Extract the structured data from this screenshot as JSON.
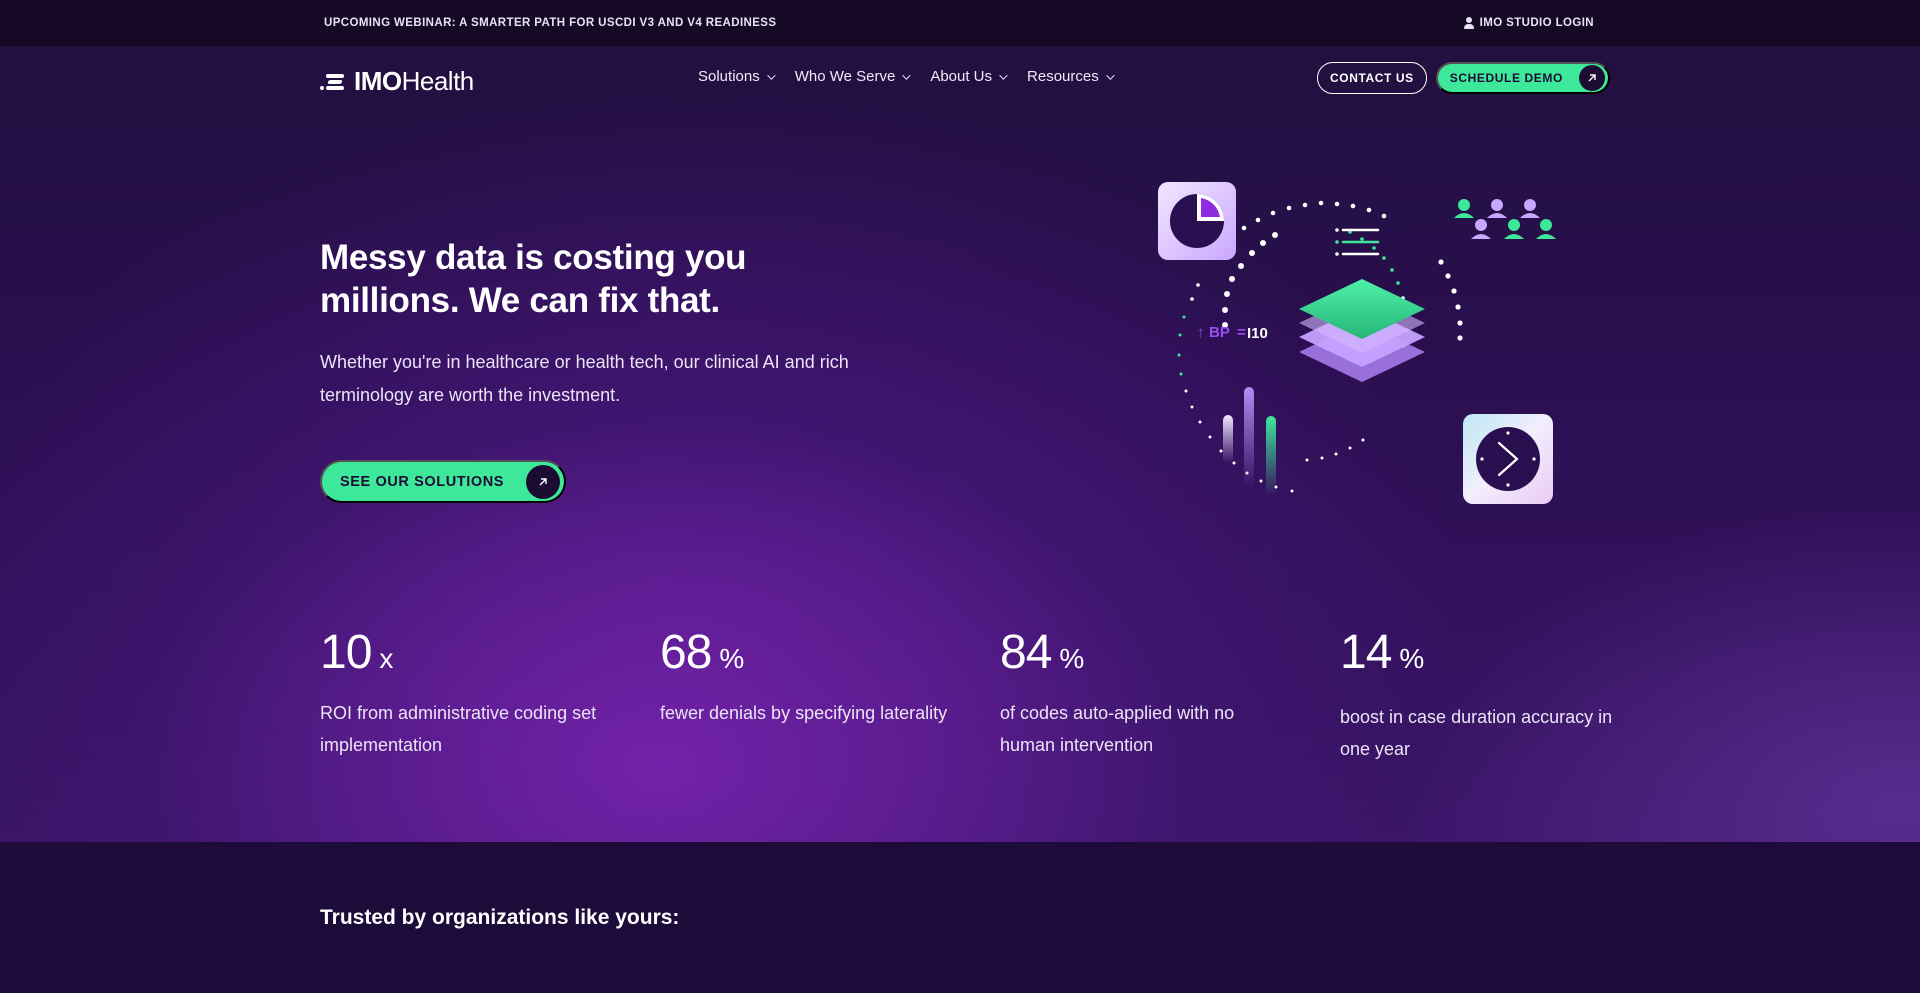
{
  "topbar": {
    "announcement": "UPCOMING WEBINAR: A SMARTER PATH FOR USCDI V3 AND V4 READINESS",
    "login": "IMO STUDIO LOGIN"
  },
  "nav": {
    "logo_bold": "IMO",
    "logo_light": "Health",
    "menu": [
      {
        "label": "Solutions"
      },
      {
        "label": "Who We Serve"
      },
      {
        "label": "About Us"
      },
      {
        "label": "Resources"
      }
    ],
    "contact_label": "CONTACT US",
    "demo_label": "SCHEDULE DEMO"
  },
  "hero": {
    "headline": "Messy data is costing you millions. We can fix that.",
    "subtext": "Whether you're in healthcare or health tech, our clinical AI and rich terminology are worth the investment.",
    "cta_label": "SEE OUR SOLUTIONS",
    "illustration_text": "BP",
    "illustration_code": "I10"
  },
  "stats": [
    {
      "value": "10",
      "unit": "x",
      "label": "ROI from administrative coding set implementation"
    },
    {
      "value": "68",
      "unit": "%",
      "label": "fewer denials by specifying laterality"
    },
    {
      "value": "84",
      "unit": "%",
      "label": "of codes auto-applied with no human intervention"
    },
    {
      "value": "14",
      "unit": "%",
      "label": "boost in case duration accuracy in one year"
    }
  ],
  "trusted": {
    "heading": "Trusted by organizations like yours:"
  },
  "colors": {
    "accent_green": "#3ee89a",
    "dark_purple": "#1c0c34",
    "lavender": "#c9a6ff"
  }
}
